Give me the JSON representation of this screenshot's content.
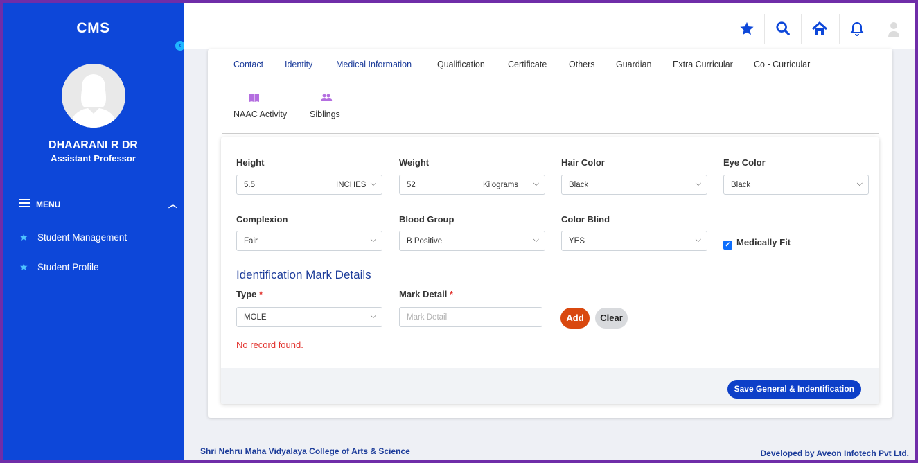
{
  "brand": "CMS",
  "user": {
    "name": "DHAARANI R DR",
    "role": "Assistant Professor"
  },
  "menu": {
    "title": "MENU",
    "items": [
      "Student Management",
      "Student Profile"
    ]
  },
  "tabs": [
    "Contact",
    "Identity",
    "Medical Information",
    "Qualification",
    "Certificate",
    "Others",
    "Guardian",
    "Extra Curricular",
    "Co - Curricular"
  ],
  "tabs2": [
    "NAAC Activity",
    "Siblings"
  ],
  "form": {
    "height": {
      "label": "Height",
      "value": "5.5",
      "unit": "INCHES"
    },
    "weight": {
      "label": "Weight",
      "value": "52",
      "unit": "Kilograms"
    },
    "hair_color": {
      "label": "Hair Color",
      "value": "Black"
    },
    "eye_color": {
      "label": "Eye Color",
      "value": "Black"
    },
    "complexion": {
      "label": "Complexion",
      "value": "Fair"
    },
    "blood_group": {
      "label": "Blood Group",
      "value": "B Positive"
    },
    "color_blind": {
      "label": "Color Blind",
      "value": "YES"
    },
    "medically_fit": {
      "label": "Medically Fit",
      "checked": true
    }
  },
  "identification": {
    "heading": "Identification Mark Details",
    "type_label": "Type",
    "type_value": "MOLE",
    "mark_label": "Mark Detail",
    "mark_placeholder": "Mark Detail",
    "required_marker": "*",
    "add_label": "Add",
    "clear_label": "Clear",
    "empty_text": "No record found."
  },
  "save_label": "Save General & Indentification",
  "footer": {
    "left": "Shri Nehru Maha Vidyalaya College of Arts & Science",
    "right": "Developed by Aveon Infotech Pvt Ltd."
  },
  "topbar_icons": [
    "star-icon",
    "search-icon",
    "home-icon",
    "bell-icon",
    "user-icon"
  ],
  "colors": {
    "sidebar": "#0d47d9",
    "accent": "#0d3fc8",
    "add_button": "#d9480f",
    "border": "#6f2da8"
  }
}
